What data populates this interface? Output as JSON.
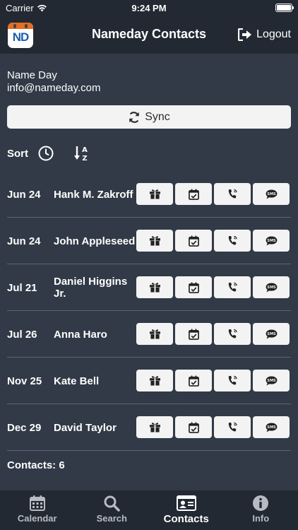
{
  "status_bar": {
    "carrier": "Carrier",
    "time": "9:24 PM"
  },
  "header": {
    "logo_text": "ND",
    "title": "Nameday Contacts",
    "logout_label": "Logout"
  },
  "profile": {
    "name": "Name Day",
    "email": "info@nameday.com"
  },
  "sync": {
    "label": "Sync"
  },
  "sort": {
    "label": "Sort"
  },
  "contacts": [
    {
      "date": "Jun 24",
      "name": "Hank M. Zakroff"
    },
    {
      "date": "Jun 24",
      "name": "John Appleseed"
    },
    {
      "date": "Jul 21",
      "name": "Daniel Higgins Jr."
    },
    {
      "date": "Jul 26",
      "name": "Anna Haro"
    },
    {
      "date": "Nov 25",
      "name": "Kate Bell"
    },
    {
      "date": "Dec 29",
      "name": "David Taylor"
    }
  ],
  "actions": {
    "sms_label": "SMS"
  },
  "footer": {
    "count_label": "Contacts: 6"
  },
  "tabs": [
    {
      "label": "Calendar",
      "icon": "calendar-icon",
      "active": false
    },
    {
      "label": "Search",
      "icon": "search-icon",
      "active": false
    },
    {
      "label": "Contacts",
      "icon": "contact-card-icon",
      "active": true
    },
    {
      "label": "Info",
      "icon": "info-icon",
      "active": false
    }
  ],
  "colors": {
    "background": "#313a46",
    "bar": "#222932",
    "button": "#f3f3f3",
    "logo_accent": "#e66d24",
    "logo_text": "#1d5fb0"
  }
}
